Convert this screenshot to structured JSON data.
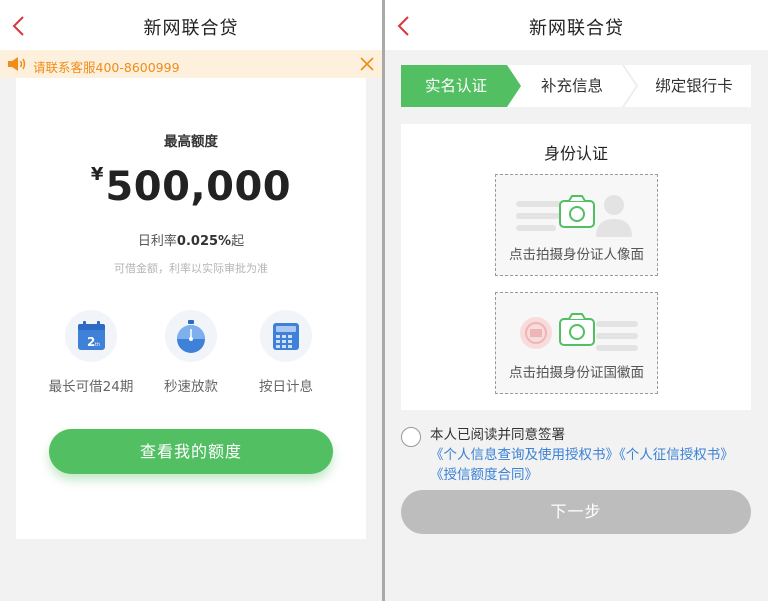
{
  "left": {
    "title": "新网联合贷",
    "notice": "请联系客服400-8600999",
    "max_label": "最高额度",
    "currency": "¥",
    "amount": "500,000",
    "rate_prefix": "日利率",
    "rate_value": "0.025%",
    "rate_suffix": "起",
    "hint": "可借金额，利率以实际审批为准",
    "features": [
      {
        "label": "最长可借24期",
        "icon": "calendar-icon"
      },
      {
        "label": "秒速放款",
        "icon": "stopwatch-icon"
      },
      {
        "label": "按日计息",
        "icon": "calculator-icon"
      }
    ],
    "cta": "查看我的额度"
  },
  "right": {
    "title": "新网联合贷",
    "steps": [
      "实名认证",
      "补充信息",
      "绑定银行卡"
    ],
    "active_step": 0,
    "section_title": "身份认证",
    "upload_front": "点击拍摄身份证人像面",
    "upload_back": "点击拍摄身份证国徽面",
    "agree_prefix": "本人已阅读并同意签署",
    "agree_links": [
      "《个人信息查询及使用授权书》",
      "《个人征信授权书》",
      "《授信额度合同》"
    ],
    "next": "下一步"
  },
  "colors": {
    "brand_green": "#52bf63",
    "back_red": "#d9373b",
    "notice_orange": "#f08c1a",
    "notice_bg": "#fdf0dc",
    "link_blue": "#3a82d6",
    "disabled_gray": "#bdbdbd"
  }
}
